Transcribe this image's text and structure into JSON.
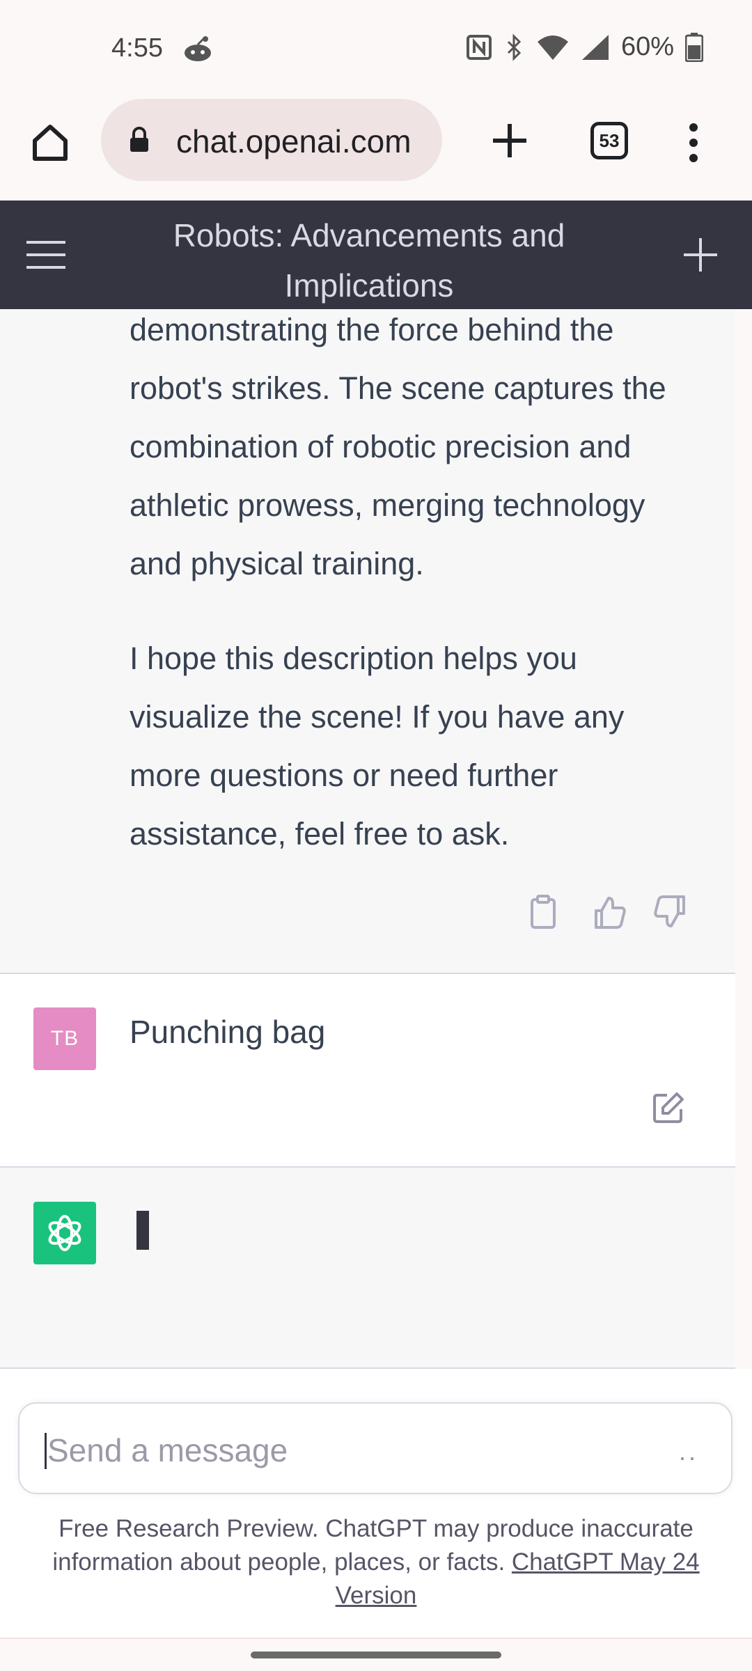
{
  "status_bar": {
    "time": "4:55",
    "battery_text": "60%",
    "icons": [
      "reddit-icon",
      "nfc-icon",
      "bluetooth-icon",
      "wifi-icon",
      "cellular-signal-icon",
      "battery-icon"
    ]
  },
  "browser": {
    "url": "chat.openai.com",
    "tab_count": "53",
    "icons": [
      "home-icon",
      "lock-icon",
      "plus-icon",
      "tabs-icon",
      "more-vert-icon"
    ]
  },
  "chat_header": {
    "title": "Robots: Advancements and Implications",
    "icons": [
      "hamburger-menu-icon",
      "new-chat-plus-icon"
    ]
  },
  "messages": [
    {
      "role": "assistant",
      "paragraphs": [
        "demonstrating the force behind the robot's strikes. The scene captures the combination of robotic precision and athletic prowess, merging technology and physical training.",
        "I hope this description helps you visualize the scene! If you have any more questions or need further assistance, feel free to ask."
      ],
      "action_icons": [
        "clipboard-icon",
        "thumbs-up-icon",
        "thumbs-down-icon"
      ]
    },
    {
      "role": "user",
      "avatar_initials": "TB",
      "text": "Punching bag",
      "action_icons": [
        "edit-icon"
      ]
    },
    {
      "role": "assistant",
      "avatar_icon": "openai-logo-icon",
      "streaming": true
    }
  ],
  "composer": {
    "placeholder": "Send a message",
    "send_indicator": "··"
  },
  "footer": {
    "note": "Free Research Preview. ChatGPT may produce inaccurate information about people, places, or facts.",
    "link_text": "ChatGPT May 24 Version"
  },
  "colors": {
    "header_bg": "#343541",
    "assistant_bg": "#f7f7f8",
    "user_avatar": "#e58cc4",
    "gpt_avatar": "#19c37d",
    "url_pill": "#f0e3e3"
  }
}
